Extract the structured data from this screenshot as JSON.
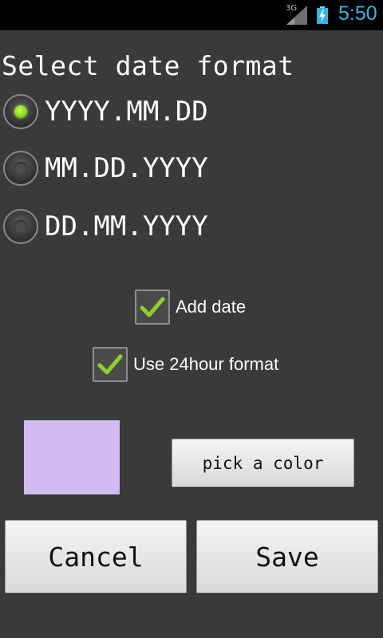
{
  "status_bar": {
    "network_type": "3G",
    "time": "5:50",
    "clock_color": "#33b5e5",
    "icons": [
      "signal-icon",
      "battery-charging-icon"
    ]
  },
  "title": "Select date format",
  "date_formats": [
    {
      "label": "YYYY.MM.DD",
      "selected": true
    },
    {
      "label": "MM.DD.YYYY",
      "selected": false
    },
    {
      "label": "DD.MM.YYYY",
      "selected": false
    }
  ],
  "options": {
    "add_date": {
      "label": "Add date",
      "checked": true
    },
    "use_24hour": {
      "label": "Use 24hour format",
      "checked": true
    }
  },
  "color": {
    "swatch_color": "#d2bbf1",
    "pick_label": "pick a color"
  },
  "actions": {
    "cancel_label": "Cancel",
    "save_label": "Save"
  },
  "accent_colors": {
    "radio_selected": "#8ad11a",
    "check_mark": "#8fd12a"
  }
}
